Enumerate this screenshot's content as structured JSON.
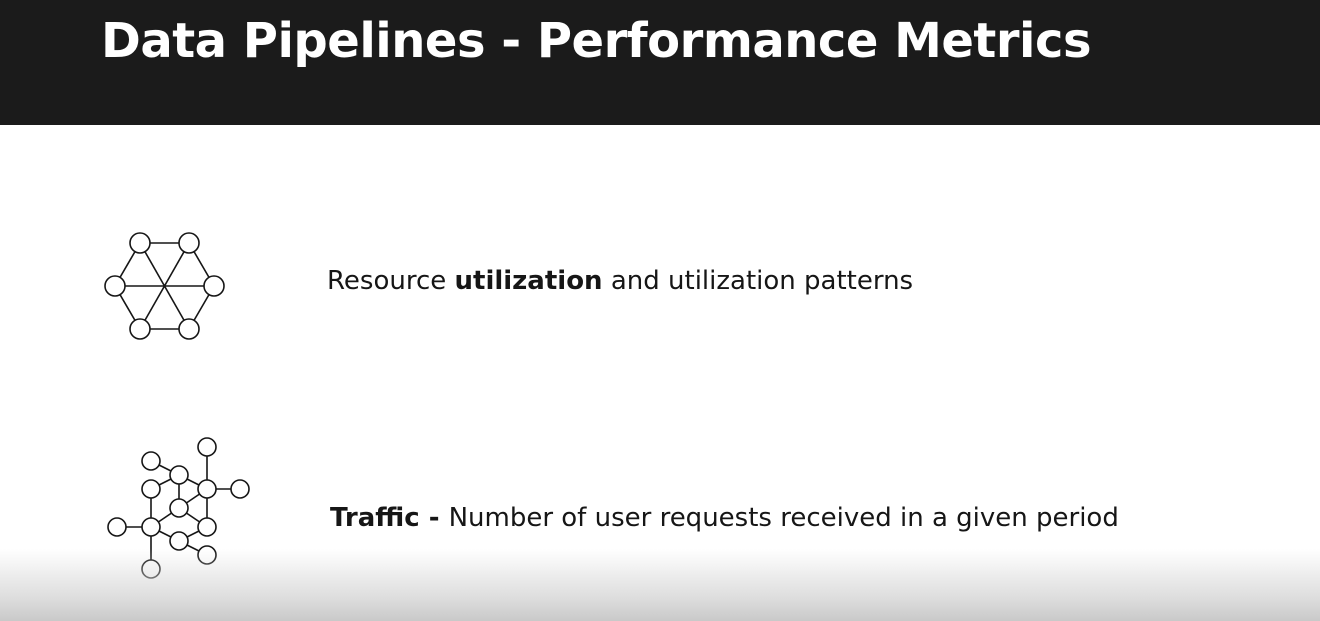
{
  "slide": {
    "title": "Data Pipelines - Performance Metrics"
  },
  "bullets": [
    {
      "icon": "hexagon-network-icon",
      "parts": [
        "Resource ",
        "utilization",
        " and utilization patterns"
      ]
    },
    {
      "icon": "node-network-icon",
      "parts": [
        "Traffic",
        " - ",
        "Number of user requests received in a given period"
      ]
    }
  ],
  "colors": {
    "header_bg": "#1b1b1b",
    "title_text": "#ffffff",
    "body_text": "#161616",
    "icon_stroke": "#161616"
  }
}
